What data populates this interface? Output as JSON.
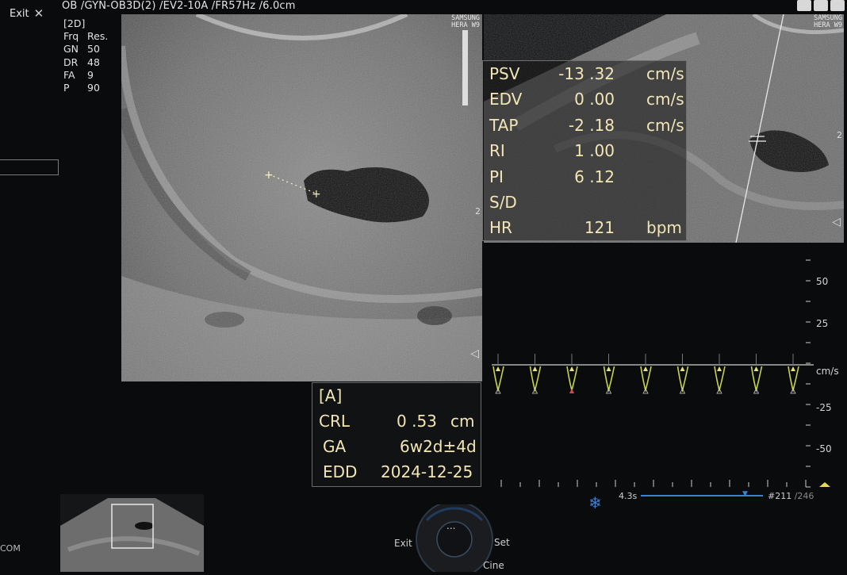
{
  "header": {
    "exam_info": "OB /GYN-OB3D(2) /EV2-10A /FR57Hz /6.0cm",
    "exit_label": "Exit"
  },
  "params": {
    "mode": "[2D]",
    "rows": [
      {
        "k": "Frq",
        "v": "Res."
      },
      {
        "k": "GN",
        "v": "50"
      },
      {
        "k": "DR",
        "v": "48"
      },
      {
        "k": "FA",
        "v": "9"
      },
      {
        "k": "P",
        "v": "90"
      }
    ]
  },
  "brand": {
    "line1": "SAMSUNG",
    "line2": "HERA W9"
  },
  "doppler": {
    "rows": [
      {
        "label": "PSV",
        "value": "-13 .32",
        "unit": "cm/s"
      },
      {
        "label": "EDV",
        "value": "0 .00",
        "unit": "cm/s"
      },
      {
        "label": "TAP",
        "value": "-2 .18",
        "unit": "cm/s"
      },
      {
        "label": "RI",
        "value": "1 .00",
        "unit": ""
      },
      {
        "label": "PI",
        "value": "6 .12",
        "unit": ""
      },
      {
        "label": "S/D",
        "value": "",
        "unit": ""
      },
      {
        "label": "HR",
        "value": "121",
        "unit": "bpm"
      }
    ]
  },
  "measurement": {
    "title": "[A]",
    "rows": [
      {
        "label": "CRL",
        "value": "0 .53",
        "unit": "cm"
      },
      {
        "label": "GA",
        "value": "6w2d±4d",
        "unit": ""
      },
      {
        "label": "EDD",
        "value": "2024-12-25",
        "unit": ""
      }
    ]
  },
  "spectrum_scale": {
    "labels": [
      "50",
      "25",
      "cm/s",
      "-25",
      "-50"
    ],
    "unit": "cm/s"
  },
  "cine": {
    "time": "4.3s",
    "frame": "#211",
    "total": "/246"
  },
  "controls": {
    "exit": "Exit",
    "set": "Set",
    "cine": "Cine",
    "menu": "..."
  },
  "side_marks": {
    "left_image_marker": "2",
    "right_image_marker": "2"
  },
  "footer": {
    "left_text": "COM"
  },
  "colors": {
    "doppler_text": "#f2e6b6",
    "waveform": "#c8d44a",
    "accent_blue": "#3e7fd0"
  }
}
